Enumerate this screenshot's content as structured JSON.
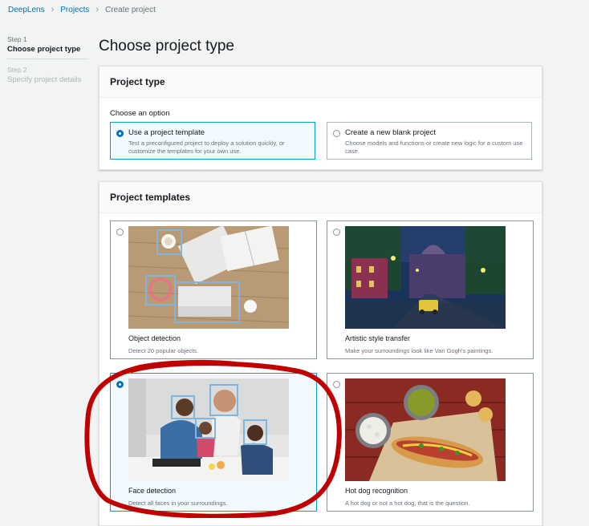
{
  "breadcrumb": {
    "items": [
      "DeepLens",
      "Projects",
      "Create project"
    ]
  },
  "steps": [
    {
      "num": "Step 1",
      "title": "Choose project type"
    },
    {
      "num": "Step 2",
      "title": "Specify project details"
    }
  ],
  "page_title": "Choose project type",
  "project_type": {
    "header": "Project type",
    "choose_label": "Choose an option",
    "options": [
      {
        "title": "Use a project template",
        "desc": "Test a preconfigured project to deploy a solution quickly, or customize the templates for your own use.",
        "selected": true
      },
      {
        "title": "Create a new blank project",
        "desc": "Choose models and functions or create new logic for a custom use case.",
        "selected": false
      }
    ]
  },
  "templates": {
    "header": "Project templates",
    "items": [
      {
        "title": "Object detection",
        "desc": "Detect 20 popular objects.",
        "selected": false
      },
      {
        "title": "Artistic style transfer",
        "desc": "Make your surroundings look like Van Gogh's paintings.",
        "selected": false
      },
      {
        "title": "Face detection",
        "desc": "Detect all faces in your surroundings.",
        "selected": true
      },
      {
        "title": "Hot dog recognition",
        "desc": "A hot dog or not a hot dog, that is the question.",
        "selected": false
      }
    ]
  },
  "colors": {
    "link": "#0073bb",
    "selected_border": "#00a1c9",
    "selected_bg": "#f1faff",
    "annotation": "#c00000"
  }
}
